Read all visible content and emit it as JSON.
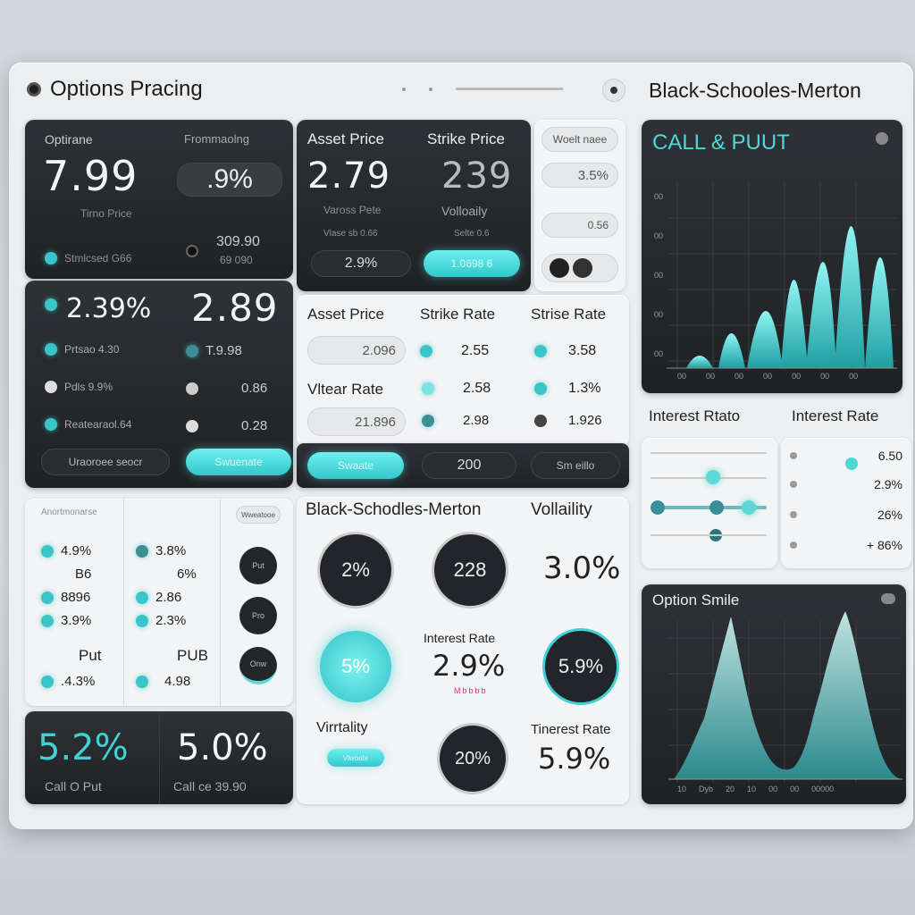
{
  "header": {
    "title": "Options Pracing",
    "right_title": "Black-Schooles-Merton"
  },
  "tl": {
    "label_left": "Optirane",
    "label_right": "Frommaolng",
    "big_value": "7.99",
    "pct_pill": ".9%",
    "sub_label": "Tirno Price",
    "row1_left": "Stmlcsed G66",
    "row1_right_top": "309.90",
    "row1_right_bot": "69 090",
    "big2_left": "2.39%",
    "big2_right": "2.89",
    "rows": [
      {
        "l": "Prtsao 4.30",
        "r": "T.9.98"
      },
      {
        "l": "Pdls 9.9%",
        "r": "0.86"
      },
      {
        "l": "Reatearaol.64",
        "r": "0.28"
      }
    ],
    "btn_left": "Uraoroee seocr",
    "btn_right": "Swuenate"
  },
  "mid": {
    "asset_label": "Asset Price",
    "strike_label": "Strike Price",
    "asset_value": "2.79",
    "strike_value": "239",
    "asset_sub": "Vaross Pete",
    "strike_sub": "Volloaily",
    "asset_small": "Vlase sb 0.66",
    "strike_small": "Selte 0.6",
    "pill_dark": "2.9%",
    "pill_cyan": "1.0698 6"
  },
  "mini": {
    "title": "Woelt naee",
    "v1": "3.5%",
    "v2": "0.56"
  },
  "grid": {
    "h1": "Asset Price",
    "h2": "Strike Rate",
    "h3": "Strise Rate",
    "h4": "Vltear Rate",
    "r1": [
      "2.096",
      "2.55",
      "3.58"
    ],
    "r2": [
      "2.58",
      "1.3%"
    ],
    "r3": [
      "21.896",
      "2.98",
      "1.926"
    ],
    "btns": [
      "Swaate",
      "200",
      "Sm eillo"
    ]
  },
  "callput": {
    "title": "CALL & PUUT",
    "y_ticks": [
      "00",
      "00",
      "00",
      "00",
      "00",
      "00"
    ],
    "x_ticks": [
      "00",
      "00",
      "00",
      "00",
      "00",
      "00",
      "00"
    ]
  },
  "interest": {
    "left_title": "Interest Rtato",
    "right_title": "Interest Rate",
    "right_rows": [
      "6.50",
      "2.9%",
      "26%",
      "+ 86%"
    ]
  },
  "bl": {
    "header": "Anortmonarse",
    "side_tag": "Wweatooe",
    "col1": [
      "4.9%",
      "B6",
      "8896",
      "3.9%"
    ],
    "col2": [
      "3.8%",
      "6%",
      "2.86",
      "2.3%"
    ],
    "put_left": "Put",
    "put_right": "PUB",
    "put_left_val": ".4.3%",
    "put_right_val": "4.98",
    "btns": [
      "Put",
      "Pro",
      "Onw"
    ]
  },
  "bottom": {
    "left_big": "5.2%",
    "left_sub": "Call O Put",
    "right_big": "5.0%",
    "right_sub": "Call ce 39.90"
  },
  "bsm": {
    "title": "Black-Schodles-Merton",
    "vol_title": "Vollaility",
    "c1": "2%",
    "c2": "228",
    "c3_text": "3.0%",
    "c4": "5%",
    "int_label": "Interest Rate",
    "int_value": "2.9%",
    "int_small": "Mbbbb",
    "c5": "5.9%",
    "vol2": "Virrtality",
    "pill": "Vlwoate",
    "c6": "20%",
    "int2_label": "Tinerest Rate",
    "int2_value": "5.9%"
  },
  "smile": {
    "title": "Option Smile",
    "x_ticks": [
      "10",
      "Dyb",
      "20",
      "10",
      "00",
      "00",
      "00000"
    ]
  },
  "colors": {
    "accent": "#3ac6c9",
    "dark": "#25282b"
  }
}
